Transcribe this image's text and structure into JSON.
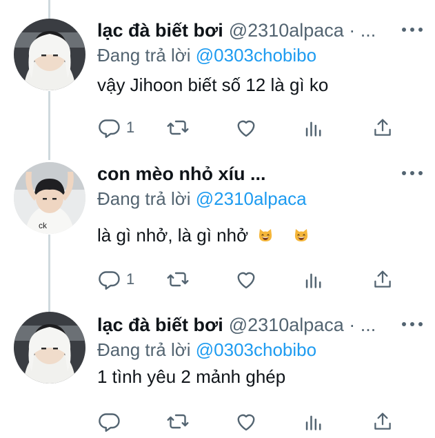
{
  "tweets": [
    {
      "name": "lạc đà biết bơi",
      "handle": "@2310alpaca · ...",
      "replying_prefix": "Đang trả lời ",
      "replying_to": "@0303chobibo",
      "text": "vậy Jihoon biết số 12 là gì ko",
      "reply_count": "1",
      "emoji": false
    },
    {
      "name": "con mèo nhỏ xíu ...",
      "handle": "",
      "replying_prefix": "Đang trả lời ",
      "replying_to": "@2310alpaca",
      "text": "là gì nhở, là gì nhở",
      "reply_count": "1",
      "emoji": true
    },
    {
      "name": "lạc đà biết bơi",
      "handle": "@2310alpaca · ...",
      "replying_prefix": "Đang trả lời ",
      "replying_to": "@0303chobibo",
      "text": "1 tình yêu 2 mảnh ghép",
      "reply_count": "",
      "emoji": false
    }
  ],
  "icons": {
    "reply": "reply-icon",
    "retweet": "retweet-icon",
    "like": "heart-icon",
    "views": "analytics-icon",
    "share": "share-icon",
    "more": "more-icon",
    "emoji": "grinning-cat-emoji"
  },
  "colors": {
    "text": "#0f1419",
    "secondary": "#536471",
    "mention": "#1d9bf0",
    "thread_line": "#cfd9de",
    "background": "#ffffff"
  }
}
